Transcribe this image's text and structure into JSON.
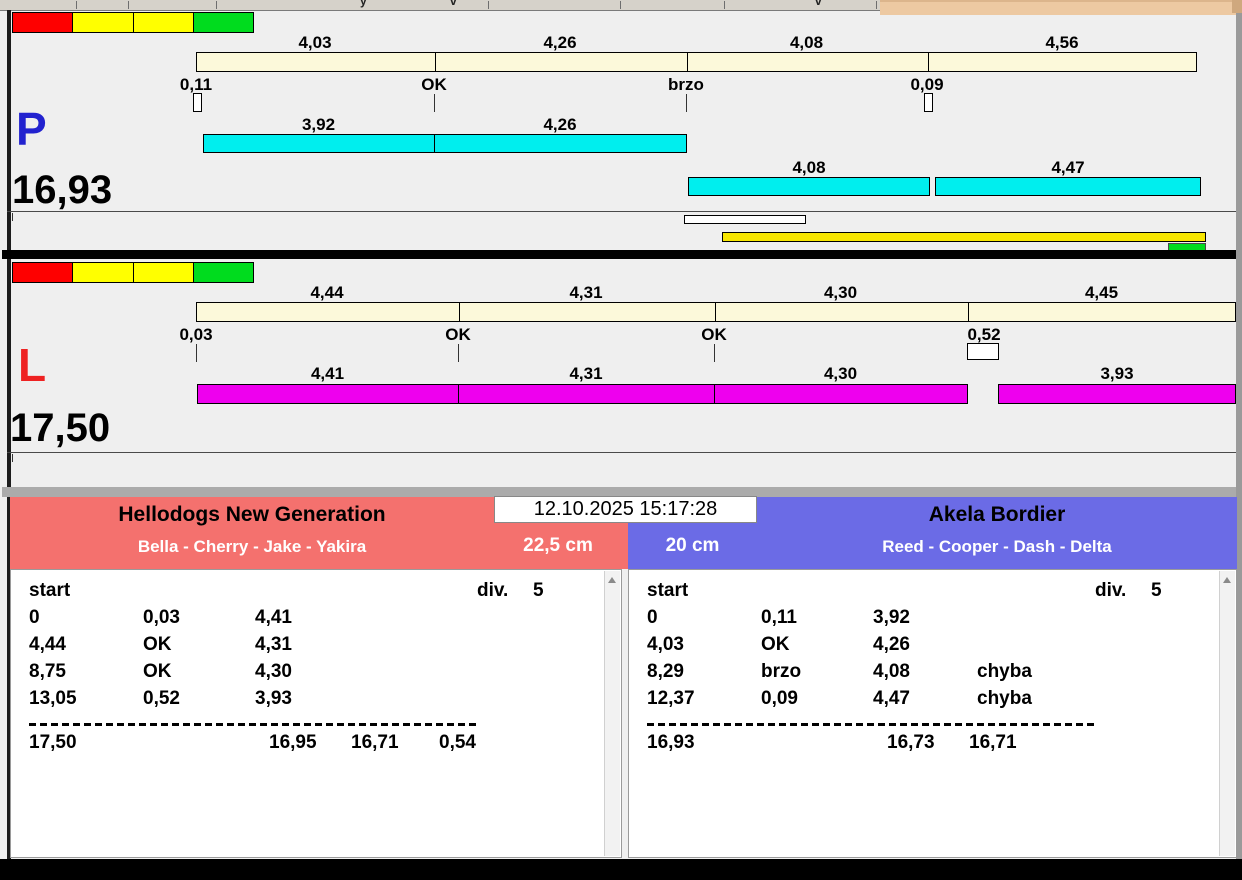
{
  "colors": {
    "lane_background": "#efefef",
    "split_bar": "#fcf9da",
    "lane_p_bar": "#00eeee",
    "lane_l_bar": "#ee00ee",
    "lane_p_letter": "#2222cf",
    "lane_l_letter": "#ee2222",
    "team_left_header": "#f4716e",
    "team_right_header": "#6b6be6",
    "traffic": [
      "#fe0000",
      "#ffff00",
      "#ffff00",
      "#00dc1e"
    ]
  },
  "datetime": "12.10.2025 15:17:28",
  "lanes": [
    {
      "letter": "P",
      "total": "16,93",
      "split_segments": [
        "4,03",
        "4,26",
        "4,08",
        "4,56"
      ],
      "markers": [
        "0,11",
        "OK",
        "brzo",
        "0,09"
      ],
      "run_row1": [
        "3,92",
        "4,26"
      ],
      "run_row2": [
        "4,08",
        "4,47"
      ]
    },
    {
      "letter": "L",
      "total": "17,50",
      "split_segments": [
        "4,44",
        "4,31",
        "4,30",
        "4,45"
      ],
      "markers": [
        "0,03",
        "OK",
        "OK",
        "0,52"
      ],
      "runs": [
        "4,41",
        "4,31",
        "4,30",
        "3,93"
      ]
    }
  ],
  "teams": {
    "left": {
      "name": "Hellodogs New Generation",
      "dogs": "Bella - Cherry - Jake - Yakira",
      "height": "22,5 cm",
      "start_label": "start",
      "division_label": "div.",
      "division": "5",
      "rows": [
        [
          "0",
          "0,03",
          "4,41",
          ""
        ],
        [
          "4,44",
          "OK",
          "4,31",
          ""
        ],
        [
          "8,75",
          "OK",
          "4,30",
          ""
        ],
        [
          "13,05",
          "0,52",
          "3,93",
          ""
        ]
      ],
      "totals": [
        "17,50",
        "16,95",
        "16,71",
        "0,54"
      ]
    },
    "right": {
      "name": "Akela Bordier",
      "dogs": "Reed - Cooper - Dash - Delta",
      "height": "20 cm",
      "start_label": "start",
      "division_label": "div.",
      "division": "5",
      "rows": [
        [
          "0",
          "0,11",
          "3,92",
          ""
        ],
        [
          "4,03",
          "OK",
          "4,26",
          ""
        ],
        [
          "8,29",
          "brzo",
          "4,08",
          "chyba"
        ],
        [
          "12,37",
          "0,09",
          "4,47",
          "chyba"
        ]
      ],
      "totals": [
        "16,93",
        "16,73",
        "16,71",
        ""
      ]
    }
  }
}
